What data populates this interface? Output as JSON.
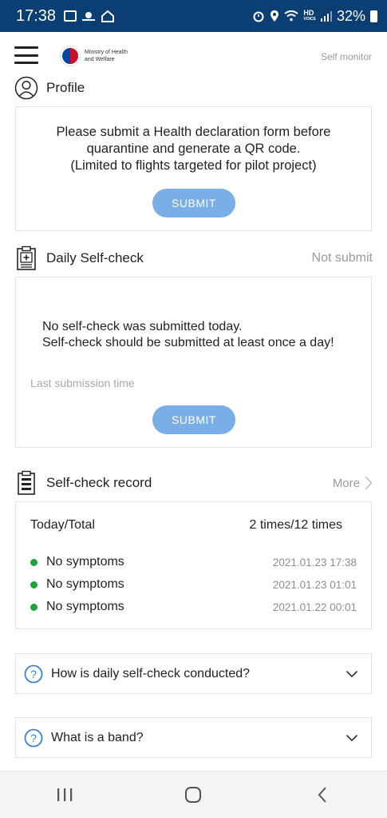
{
  "status_bar": {
    "time": "17:38",
    "network": "HD",
    "network_sub": "VOICE",
    "battery": "32%"
  },
  "header": {
    "menu_icon": "hamburger-menu-icon",
    "logo_line1": "Ministry of Health",
    "logo_line2": "and Welfare",
    "self_monitor": "Self monitor"
  },
  "profile": {
    "title": "Profile",
    "message_line1": "Please submit a Health declaration form before",
    "message_line2": "quarantine and generate a QR code.",
    "message_line3": "(Limited to flights targeted for pilot project)",
    "submit_label": "SUBMIT"
  },
  "daily": {
    "title": "Daily Self-check",
    "status": "Not submit",
    "message_line1": "No self-check was submitted today.",
    "message_line2": "Self-check should be submitted at least once a day!",
    "last_submission": "Last submission time",
    "submit_label": "SUBMIT"
  },
  "record": {
    "title": "Self-check record",
    "more_label": "More",
    "today_total_label": "Today/Total",
    "today_total_value": "2 times/12 times",
    "rows": [
      {
        "symptom": "No symptoms",
        "time": "2021.01.23 17:38"
      },
      {
        "symptom": "No symptoms",
        "time": "2021.01.23 01:01"
      },
      {
        "symptom": "No symptoms",
        "time": "2021.01.22 00:01"
      }
    ]
  },
  "faq": [
    {
      "question": "How is daily self-check conducted?"
    },
    {
      "question": "What is a band?"
    }
  ],
  "colors": {
    "status_bar": "#0b3f73",
    "accent_button": "#7aaee6",
    "symptom_dot": "#1fa339",
    "faq_icon": "#3b82c4"
  }
}
